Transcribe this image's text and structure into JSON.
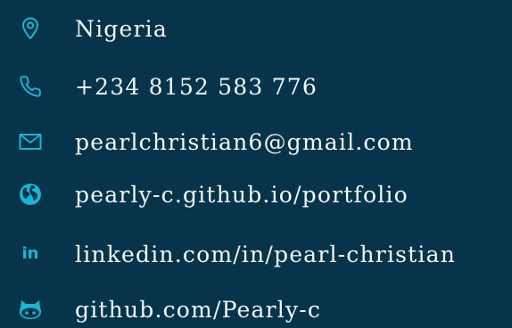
{
  "contacts": {
    "location": {
      "icon": "map-pin-icon",
      "text": "Nigeria"
    },
    "phone": {
      "icon": "phone-icon",
      "text": "+234 8152 583 776"
    },
    "email": {
      "icon": "mail-icon",
      "text": "pearlchristian6@gmail.com"
    },
    "website": {
      "icon": "globe-icon",
      "text": "pearly-c.github.io/portfolio"
    },
    "linkedin": {
      "icon": "linkedin-icon",
      "glyph": "in",
      "text": "linkedin.com/in/pearl-christian"
    },
    "github": {
      "icon": "github-icon",
      "text": "github.com/Pearly-c"
    }
  },
  "colors": {
    "background": "#07344a",
    "accent": "#18b6d6",
    "text": "#f2f6f8"
  }
}
